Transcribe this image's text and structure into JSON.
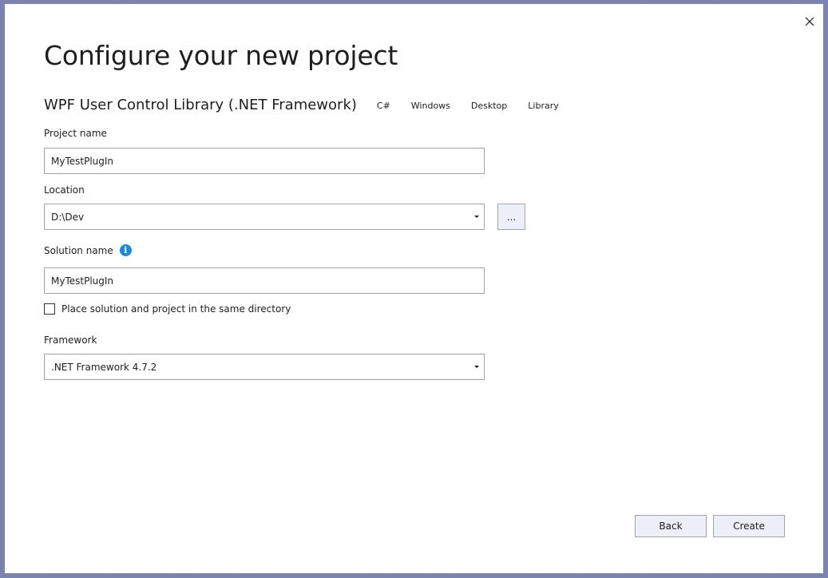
{
  "dialog": {
    "title": "Configure your new project",
    "close_icon": "close-icon"
  },
  "template": {
    "name": "WPF User Control Library (.NET Framework)",
    "tags": [
      "C#",
      "Windows",
      "Desktop",
      "Library"
    ]
  },
  "project_name": {
    "label": "Project name",
    "value": "MyTestPlugIn"
  },
  "location": {
    "label": "Location",
    "value": "D:\\Dev",
    "browse_label": "..."
  },
  "solution_name": {
    "label": "Solution name",
    "info_icon": "info-icon",
    "value": "MyTestPlugIn"
  },
  "same_directory": {
    "label": "Place solution and project in the same directory",
    "checked": false
  },
  "framework": {
    "label": "Framework",
    "value": ".NET Framework 4.7.2"
  },
  "buttons": {
    "back": "Back",
    "create": "Create"
  },
  "colors": {
    "border": "#7b83b0",
    "button_bg": "#eceef8",
    "info_blue": "#1c8ad6"
  }
}
